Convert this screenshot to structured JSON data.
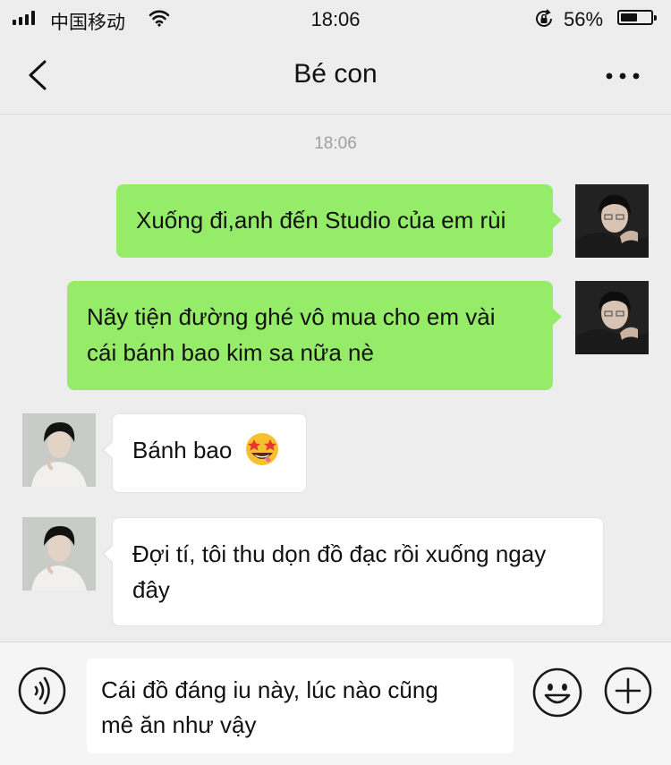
{
  "status_bar": {
    "carrier": "中国移动",
    "time": "18:06",
    "battery_percent": "56%",
    "battery_level": 0.56
  },
  "nav": {
    "title": "Bé con",
    "back_icon": "chevron-left-icon",
    "more_icon": "more-dots-icon"
  },
  "chat": {
    "timestamp": "18:06",
    "messages": [
      {
        "side": "right",
        "text": "Xuống đi,anh đến Studio của em rùi"
      },
      {
        "side": "right",
        "text_line1": "Nãy tiện đường ghé vô mua cho em vài",
        "text_line2": "cái bánh bao kim sa nữa nè"
      },
      {
        "side": "left",
        "text": "Bánh bao",
        "emoji": "star-struck-emoji"
      },
      {
        "side": "left",
        "text_line1": "Đợi tí, tôi thu dọn đồ đạc rồi xuống ngay",
        "text_line2": "đây"
      }
    ]
  },
  "input": {
    "value_line1": "Cái đồ đáng iu này, lúc nào cũng",
    "value_line2": "mê ăn như vậy",
    "voice_icon": "voice-icon",
    "emoji_icon": "smiley-icon",
    "add_icon": "plus-circle-icon"
  },
  "colors": {
    "background": "#ededed",
    "sent_bubble": "#95ec69",
    "received_bubble": "#ffffff"
  }
}
